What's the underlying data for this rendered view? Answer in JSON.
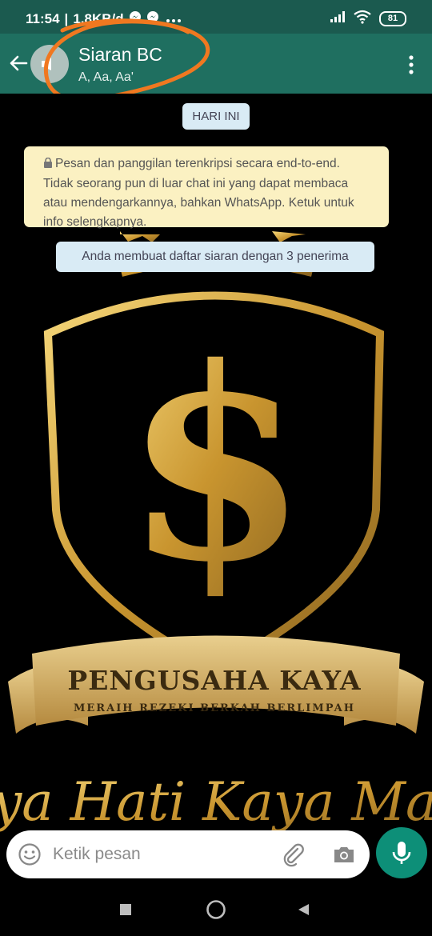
{
  "status_bar": {
    "time": "11:54",
    "network_speed": "1,8KB/d",
    "battery": "81"
  },
  "header": {
    "title": "Siaran BC",
    "subtitle": "A, Aa, Aa'"
  },
  "chat": {
    "date_label": "HARI INI",
    "encryption_notice": "Pesan dan panggilan terenkripsi secara end-to-end. Tidak seorang pun di luar chat ini yang dapat membaca atau mendengarkannya, bahkan WhatsApp. Ketuk untuk info selengkapnya.",
    "encryption_lines": [
      "Pesan dan panggilan terenkripsi secara end-to-end.",
      "Tidak seorang pun di luar chat ini yang dapat membaca",
      "atau mendengarkannya, bahkan WhatsApp. Ketuk untuk",
      "info selengkapnya."
    ],
    "system_message": "Anda membuat daftar siaran dengan 3 penerima"
  },
  "wallpaper": {
    "banner_title": "PENGUSAHA KAYA",
    "banner_subtitle": "MERAIH REZEKI BERKAH BERLIMPAH",
    "script_text": "ya Hati Kaya Manfa",
    "symbol": "$"
  },
  "input": {
    "placeholder": "Ketik pesan"
  },
  "icons": {
    "back": "arrow-left-icon",
    "menu": "more-vertical-icon",
    "emoji": "emoji-icon",
    "attach": "paperclip-icon",
    "camera": "camera-icon",
    "mic": "microphone-icon",
    "lock": "lock-icon"
  },
  "colors": {
    "status_bar": "#1b5a4f",
    "app_bar": "#1f6f60",
    "accent": "#0d8f78",
    "gold": "#d9b24a",
    "notice_bg": "#fbf1c2",
    "chip_bg": "#d9ebf5",
    "annotation": "#f07820"
  }
}
